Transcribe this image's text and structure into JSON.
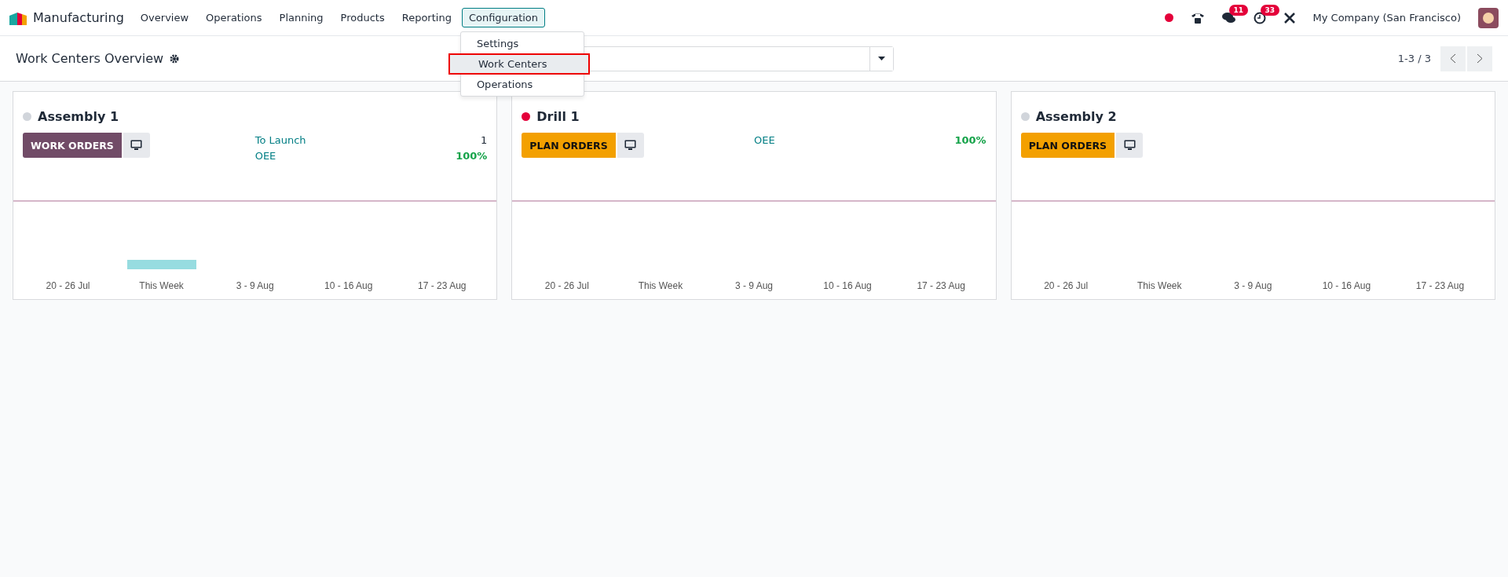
{
  "navbar": {
    "app": "Manufacturing",
    "menus": [
      {
        "label": "Overview",
        "selected": false
      },
      {
        "label": "Operations",
        "selected": false
      },
      {
        "label": "Planning",
        "selected": false
      },
      {
        "label": "Products",
        "selected": false
      },
      {
        "label": "Reporting",
        "selected": false
      },
      {
        "label": "Configuration",
        "selected": true
      }
    ],
    "dropdown": [
      {
        "label": "Settings",
        "selected": false
      },
      {
        "label": "Work Centers",
        "selected": true
      },
      {
        "label": "Operations",
        "selected": false
      }
    ],
    "chat_badge": "11",
    "activity_badge": "33",
    "company": "My Company (San Francisco)"
  },
  "control_panel": {
    "title": "Work Centers Overview",
    "pager": "1-3 / 3"
  },
  "cards": [
    {
      "name": "Assembly 1",
      "color": "#d1d5db",
      "button": {
        "label": "WORK ORDERS",
        "kind": "work"
      },
      "metrics": [
        {
          "label": "To Launch",
          "value": "1",
          "kind": "count"
        },
        {
          "label": "OEE",
          "value": "100%",
          "kind": "percent"
        }
      ],
      "weeks": [
        {
          "label": "20 - 26 Jul",
          "bar": false
        },
        {
          "label": "This Week",
          "bar": true
        },
        {
          "label": "3 - 9 Aug",
          "bar": false
        },
        {
          "label": "10 - 16 Aug",
          "bar": false
        },
        {
          "label": "17 - 23 Aug",
          "bar": false
        }
      ]
    },
    {
      "name": "Drill 1",
      "color": "#e4003a",
      "button": {
        "label": "PLAN ORDERS",
        "kind": "plan"
      },
      "metrics": [
        {
          "label": "OEE",
          "value": "100%",
          "kind": "percent"
        }
      ],
      "weeks": [
        {
          "label": "20 - 26 Jul",
          "bar": false
        },
        {
          "label": "This Week",
          "bar": false
        },
        {
          "label": "3 - 9 Aug",
          "bar": false
        },
        {
          "label": "10 - 16 Aug",
          "bar": false
        },
        {
          "label": "17 - 23 Aug",
          "bar": false
        }
      ]
    },
    {
      "name": "Assembly 2",
      "color": "#d1d5db",
      "button": {
        "label": "PLAN ORDERS",
        "kind": "plan"
      },
      "weeks": [
        {
          "label": "20 - 26 Jul",
          "bar": false
        },
        {
          "label": "This Week",
          "bar": false
        },
        {
          "label": "3 - 9 Aug",
          "bar": false
        },
        {
          "label": "10 - 16 Aug",
          "bar": false
        },
        {
          "label": "17 - 23 Aug",
          "bar": false
        }
      ]
    }
  ]
}
